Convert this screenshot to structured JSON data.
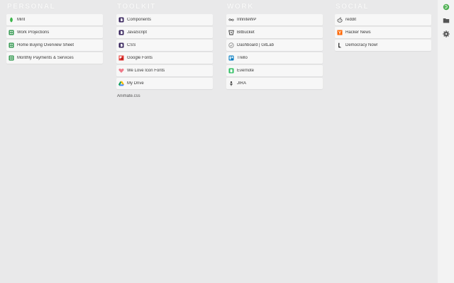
{
  "columns": [
    {
      "heading": "Personal",
      "items": [
        {
          "label": "Mint",
          "icon": "mint-icon",
          "color": "#3bb54a"
        },
        {
          "label": "Work Projections",
          "icon": "sheets-icon",
          "color": "#1e8e3e"
        },
        {
          "label": "Home Buying Overview Sheet",
          "icon": "sheets-icon",
          "color": "#1e8e3e"
        },
        {
          "label": "Monthly Payments & Services",
          "icon": "sheets-icon",
          "color": "#1e8e3e"
        }
      ]
    },
    {
      "heading": "Toolkit",
      "items": [
        {
          "label": "Components",
          "icon": "bootstrap-icon",
          "color": "#563d7c"
        },
        {
          "label": "JavaScript",
          "icon": "bootstrap-icon",
          "color": "#563d7c"
        },
        {
          "label": "CSS",
          "icon": "bootstrap-icon",
          "color": "#563d7c"
        },
        {
          "label": "Google Fonts",
          "icon": "google-fonts-icon",
          "color": "#e53935"
        },
        {
          "label": "We Love Icon Fonts",
          "icon": "heart-icon",
          "color": "#ef7a8a"
        },
        {
          "label": "My Drive",
          "icon": "drive-icon",
          "color": "#fbbc04"
        },
        {
          "label": "Animate.css",
          "icon": "",
          "color": "",
          "plain": true
        }
      ]
    },
    {
      "heading": "Work",
      "items": [
        {
          "label": "InfiniteWP",
          "icon": "infinity-icon",
          "color": "#444444"
        },
        {
          "label": "Bitbucket",
          "icon": "bitbucket-icon",
          "color": "#205081"
        },
        {
          "label": "Dashboard | GitLab",
          "icon": "gitlab-icon",
          "color": "#888888"
        },
        {
          "label": "Trello",
          "icon": "trello-icon",
          "color": "#0079bf"
        },
        {
          "label": "Evernote",
          "icon": "evernote-icon",
          "color": "#2dbe60"
        },
        {
          "label": "JIRA",
          "icon": "jira-icon",
          "color": "#333333"
        }
      ]
    },
    {
      "heading": "Social",
      "items": [
        {
          "label": "reddit",
          "icon": "reddit-icon",
          "color": "#555555"
        },
        {
          "label": "Hacker News",
          "icon": "hacker-news-icon",
          "color": "#ff6600"
        },
        {
          "label": "Democracy Now!",
          "icon": "democracy-now-icon",
          "color": "#111111"
        }
      ]
    }
  ],
  "rail": {
    "buttons": [
      {
        "icon": "extension-logo-icon",
        "color": "#4caf50"
      },
      {
        "icon": "folder-icon",
        "color": "#555555"
      },
      {
        "icon": "gear-icon",
        "color": "#555555"
      }
    ]
  }
}
